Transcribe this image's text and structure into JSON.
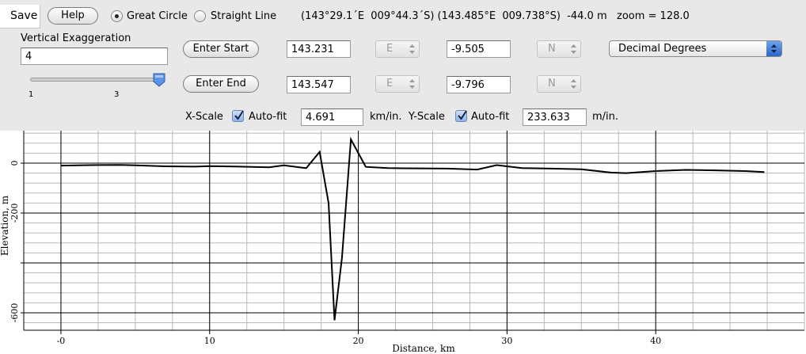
{
  "toolbar": {
    "save_label": "Save",
    "help_label": "Help",
    "great_circle_label": "Great Circle",
    "straight_line_label": "Straight Line",
    "great_circle_selected": true,
    "status_text": "(143°29.1´E  009°44.3´S) (143.485°E  009.738°S)  -44.0 m   zoom = 128.0"
  },
  "exaggeration": {
    "label": "Vertical Exaggeration",
    "value": "4",
    "slider_min_label": "1",
    "slider_mid_label": "3",
    "slider_level": 1.0
  },
  "start": {
    "button_label": "Enter Start",
    "lon_value": "143.231",
    "lon_hemisphere": "E",
    "lat_value": "-9.505",
    "lat_hemisphere": "N"
  },
  "end": {
    "button_label": "Enter End",
    "lon_value": "143.547",
    "lon_hemisphere": "E",
    "lat_value": "-9.796",
    "lat_hemisphere": "N"
  },
  "format_select": {
    "selected": "Decimal Degrees"
  },
  "scale": {
    "x_label": "X-Scale",
    "x_autofit_label": "Auto-fit",
    "x_value": "4.691",
    "x_unit_label": "km/in.  Y-Scale",
    "y_autofit_label": "Auto-fit",
    "y_value": "233.633",
    "y_unit_label": "m/in."
  },
  "colors": {
    "panel_bg": "#e8e8e8",
    "grid_minor": "#b8b8b8",
    "grid_major": "#000000",
    "line": "#000000",
    "accent_blue": "#2a66c9"
  },
  "chart_data": {
    "type": "line",
    "xlabel": "Distance, km",
    "ylabel": "Elevation, m",
    "xlim": [
      -2.5,
      50
    ],
    "ylim": [
      -670,
      130
    ],
    "x_major_ticks": [
      0,
      10,
      20,
      30,
      40
    ],
    "x_tick_labels": [
      "-0",
      "10",
      "20",
      "30",
      "40"
    ],
    "y_major_ticks": [
      0,
      -200,
      -400,
      -600
    ],
    "y_tick_labels": [
      "0",
      "-200",
      "",
      "-600"
    ],
    "x_minor_step": 2.5,
    "y_minor_step": 40,
    "grid": true,
    "x": [
      0,
      2,
      4,
      5,
      7,
      9,
      10,
      12,
      14,
      15,
      16.5,
      17.4,
      18,
      18.4,
      18.9,
      19.5,
      20.5,
      22,
      24,
      26,
      28,
      29.3,
      31,
      33,
      35,
      37,
      38,
      40,
      42,
      44,
      46,
      47.3
    ],
    "y": [
      -10,
      -8,
      -7,
      -9,
      -13,
      -14,
      -12,
      -14,
      -17,
      -9,
      -20,
      45,
      -160,
      -630,
      -380,
      95,
      -15,
      -20,
      -21,
      -22,
      -26,
      -8,
      -20,
      -22,
      -25,
      -38,
      -40,
      -32,
      -27,
      -29,
      -32,
      -36
    ]
  }
}
